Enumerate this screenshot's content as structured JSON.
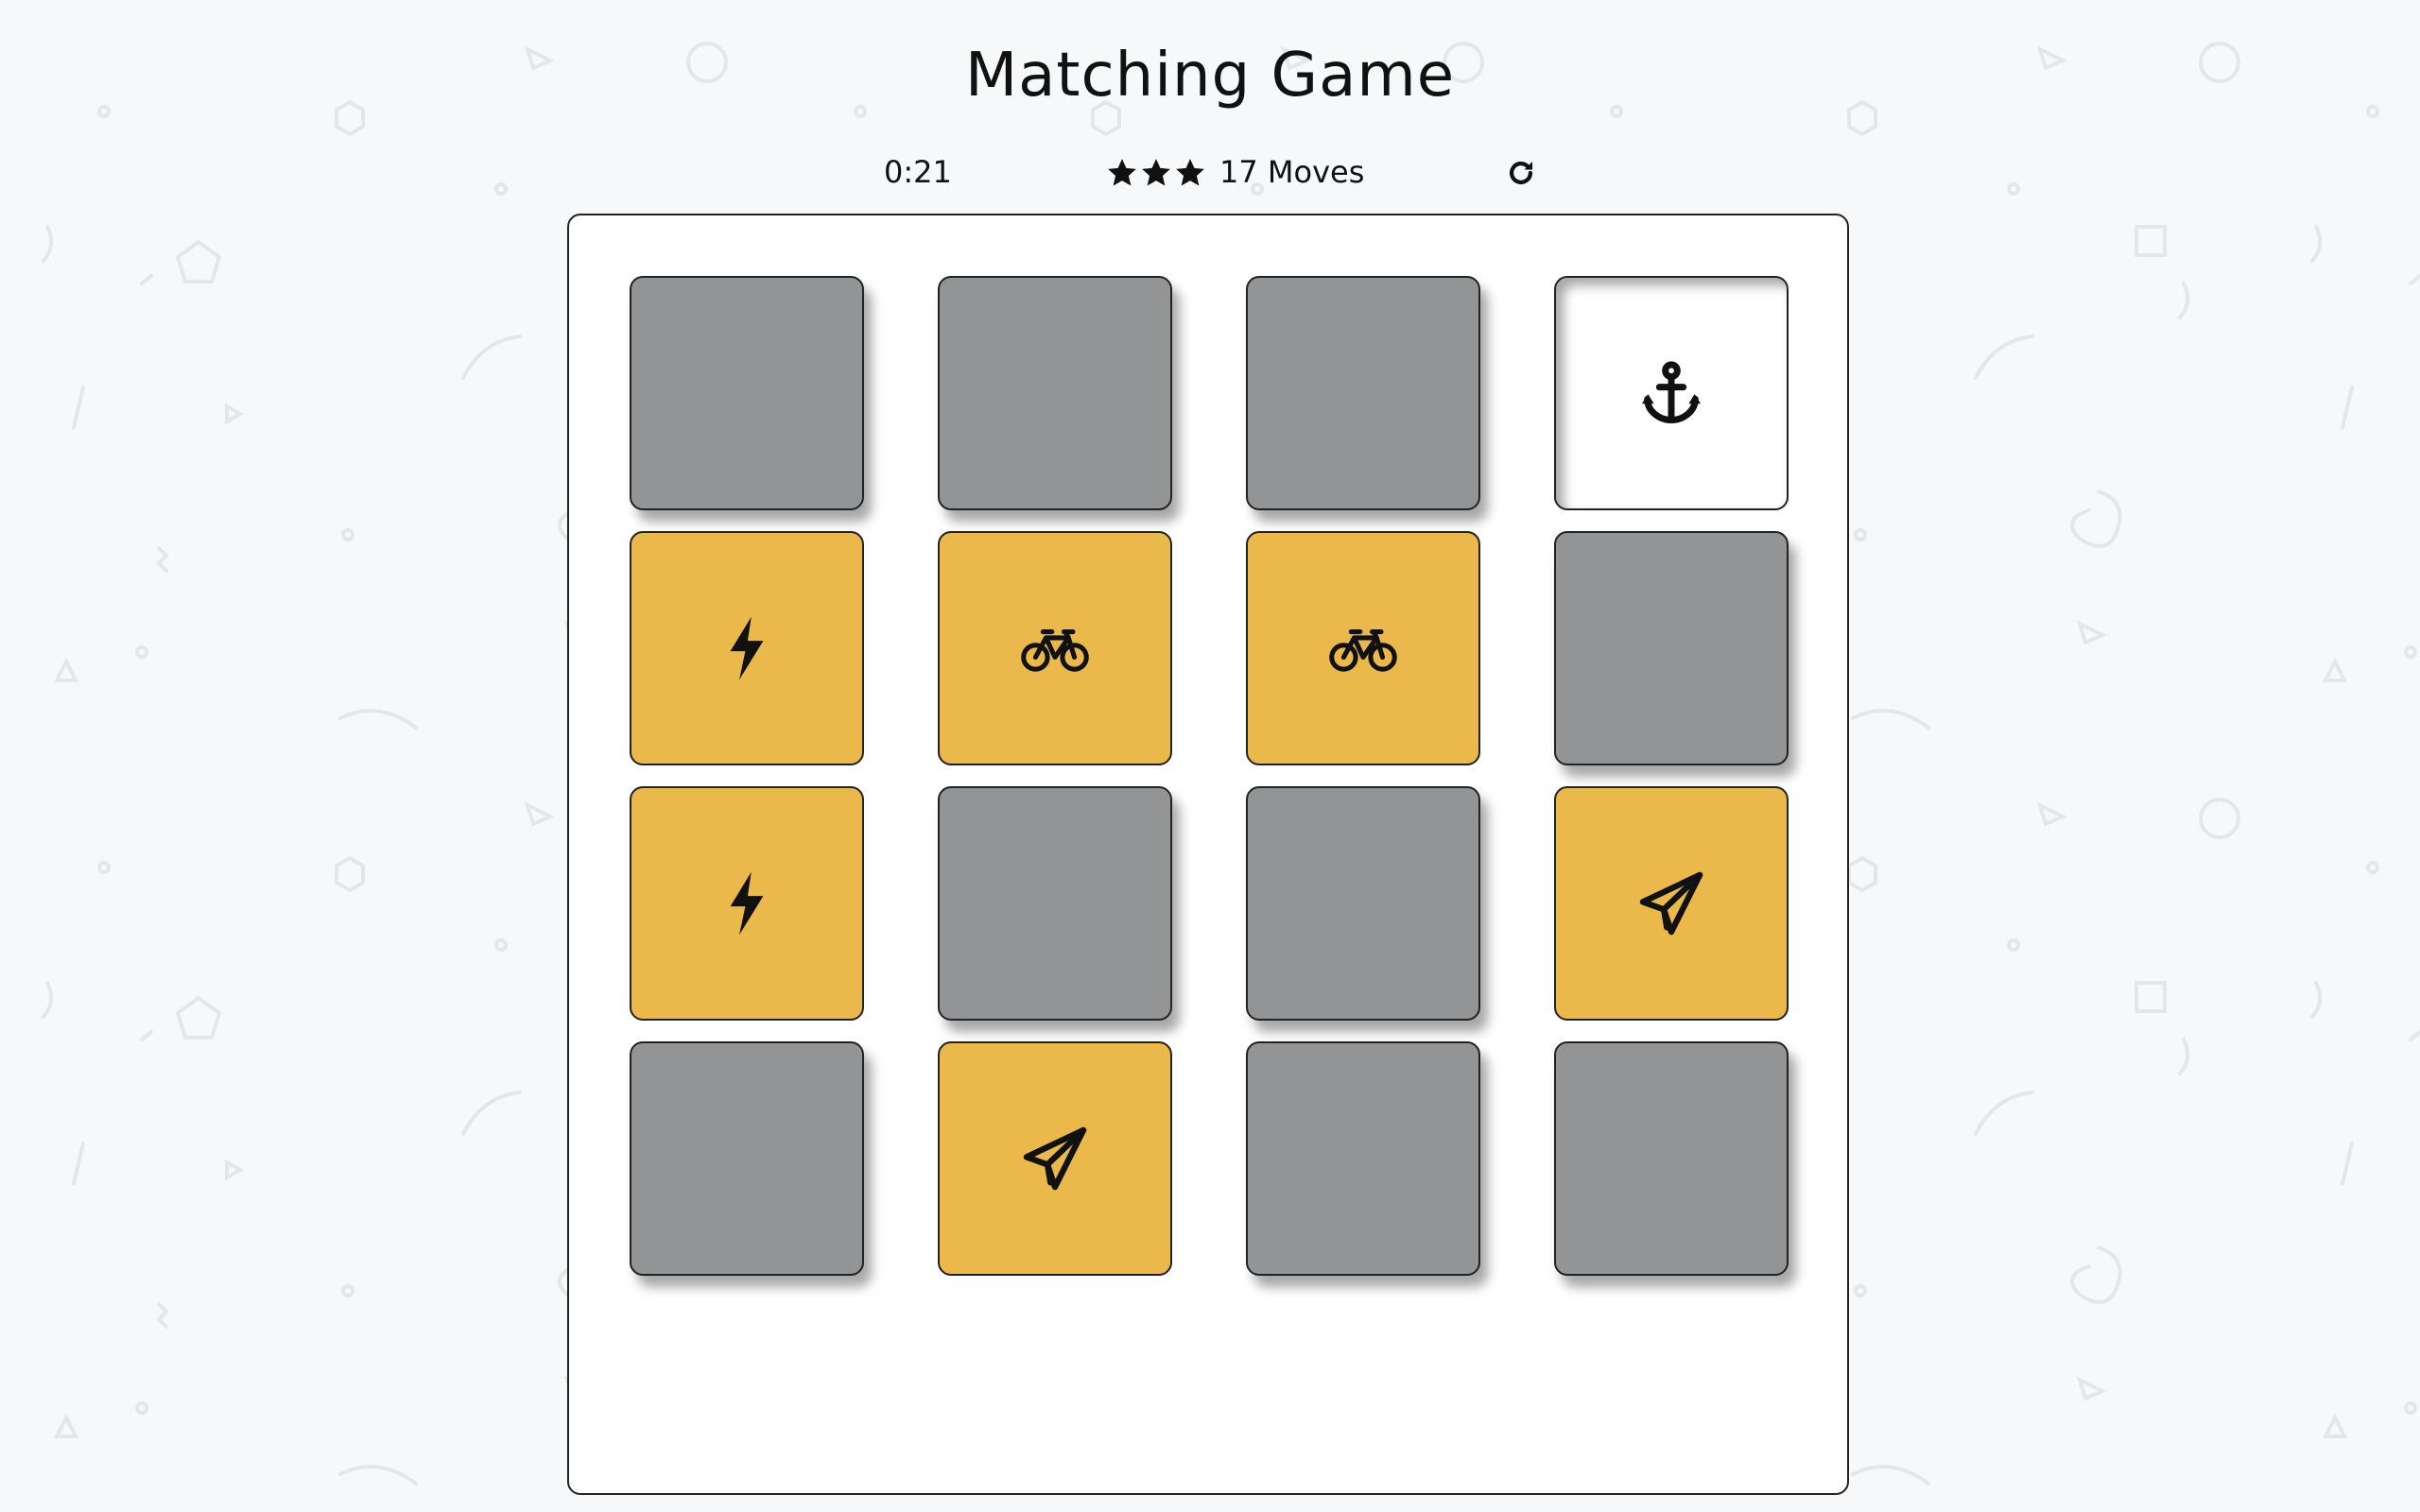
{
  "title": "Matching Game",
  "score": {
    "timer": "0:21",
    "stars": 3,
    "moves": "17 Moves",
    "restart_icon": "restart-icon"
  },
  "colors": {
    "background": "#f7f8fa",
    "card_hidden": "#939496",
    "card_matched": "#ebb84b",
    "card_open": "#ffffff"
  },
  "deck": [
    {
      "state": "hidden",
      "icon": ""
    },
    {
      "state": "hidden",
      "icon": ""
    },
    {
      "state": "hidden",
      "icon": ""
    },
    {
      "state": "open",
      "icon": "anchor"
    },
    {
      "state": "match",
      "icon": "bolt"
    },
    {
      "state": "match",
      "icon": "bicycle"
    },
    {
      "state": "match",
      "icon": "bicycle"
    },
    {
      "state": "hidden",
      "icon": ""
    },
    {
      "state": "match",
      "icon": "bolt"
    },
    {
      "state": "hidden",
      "icon": ""
    },
    {
      "state": "hidden",
      "icon": ""
    },
    {
      "state": "match",
      "icon": "paper-plane"
    },
    {
      "state": "hidden",
      "icon": ""
    },
    {
      "state": "match",
      "icon": "paper-plane"
    },
    {
      "state": "hidden",
      "icon": ""
    },
    {
      "state": "hidden",
      "icon": ""
    }
  ]
}
